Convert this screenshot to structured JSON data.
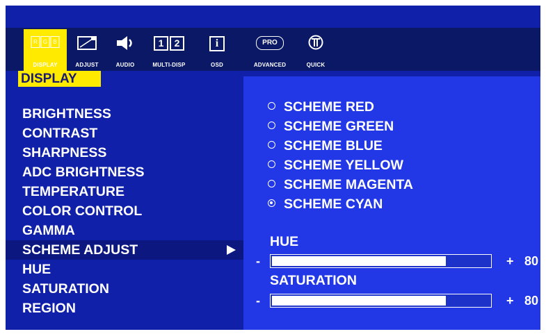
{
  "colors": {
    "bg_outer": "#ffffff",
    "panel": "#1020a8",
    "icon_bar": "#0a1866",
    "right_panel": "#2238e6",
    "accent": "#ffea00"
  },
  "tabs": [
    {
      "id": "display",
      "icon": "rgb-icon",
      "label": "DISPLAY",
      "icon_text": [
        "R",
        "G",
        "B"
      ],
      "active": true
    },
    {
      "id": "adjust",
      "icon": "adjust-screen-icon",
      "label": "ADJUST"
    },
    {
      "id": "audio",
      "icon": "speaker-icon",
      "label": "AUDIO"
    },
    {
      "id": "multi",
      "icon": "multi-display-icon",
      "label": "MULTI-DISP",
      "icon_text": [
        "1",
        "2"
      ]
    },
    {
      "id": "osd",
      "icon": "info-icon",
      "label": "OSD",
      "icon_text": "i"
    },
    {
      "id": "advanced",
      "icon": "pro-icon",
      "label": "ADVANCED",
      "icon_text": "PRO"
    },
    {
      "id": "quick",
      "icon": "quick-icon",
      "label": "QUICK"
    }
  ],
  "section_title": "DISPLAY",
  "menu": [
    {
      "label": "BRIGHTNESS"
    },
    {
      "label": "CONTRAST"
    },
    {
      "label": "SHARPNESS"
    },
    {
      "label": "ADC BRIGHTNESS"
    },
    {
      "label": "TEMPERATURE"
    },
    {
      "label": "COLOR CONTROL"
    },
    {
      "label": "GAMMA"
    },
    {
      "label": "SCHEME ADJUST",
      "selected": true
    },
    {
      "label": "HUE"
    },
    {
      "label": "SATURATION"
    },
    {
      "label": "REGION"
    }
  ],
  "schemes": [
    {
      "label": "SCHEME RED",
      "checked": false
    },
    {
      "label": "SCHEME GREEN",
      "checked": false
    },
    {
      "label": "SCHEME BLUE",
      "checked": false
    },
    {
      "label": "SCHEME YELLOW",
      "checked": false
    },
    {
      "label": "SCHEME MAGENTA",
      "checked": false
    },
    {
      "label": "SCHEME CYAN",
      "checked": true
    }
  ],
  "sliders": {
    "hue": {
      "label": "HUE",
      "minus": "-",
      "plus": "+",
      "value": "80",
      "fraction": 0.8
    },
    "saturation": {
      "label": "SATURATION",
      "minus": "-",
      "plus": "+",
      "value": "80",
      "fraction": 0.8
    }
  }
}
